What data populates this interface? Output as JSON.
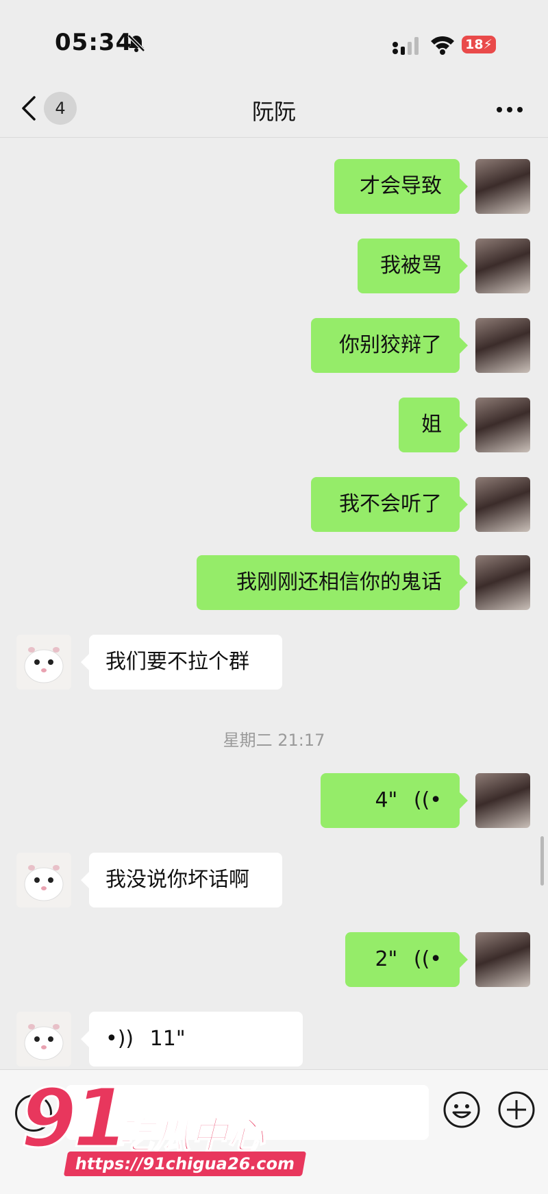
{
  "status": {
    "time": "05:34",
    "battery": "18"
  },
  "nav": {
    "back_count": "4",
    "title": "阮阮"
  },
  "messages": [
    {
      "from": "self",
      "text": "才会导致"
    },
    {
      "from": "self",
      "text": "我被骂"
    },
    {
      "from": "self",
      "text": "你别狡辩了"
    },
    {
      "from": "self",
      "text": "姐"
    },
    {
      "from": "self",
      "text": "我不会听了"
    },
    {
      "from": "self",
      "text": "我刚刚还相信你的鬼话"
    },
    {
      "from": "peer",
      "text": "我们要不拉个群"
    },
    {
      "timestamp": "星期二 21:17"
    },
    {
      "from": "self",
      "voice": "4\""
    },
    {
      "from": "peer",
      "text": "我没说你坏话啊"
    },
    {
      "from": "self",
      "voice": "2\""
    },
    {
      "from": "peer",
      "voice": "11\""
    }
  ],
  "watermark": {
    "brand_number": "91",
    "brand_text": "吃瓜中心",
    "url": "https://91chigua26.com"
  },
  "colors": {
    "self_bubble": "#95ec69",
    "peer_bubble": "#ffffff",
    "background": "#ededed",
    "watermark": "#e8375d"
  }
}
